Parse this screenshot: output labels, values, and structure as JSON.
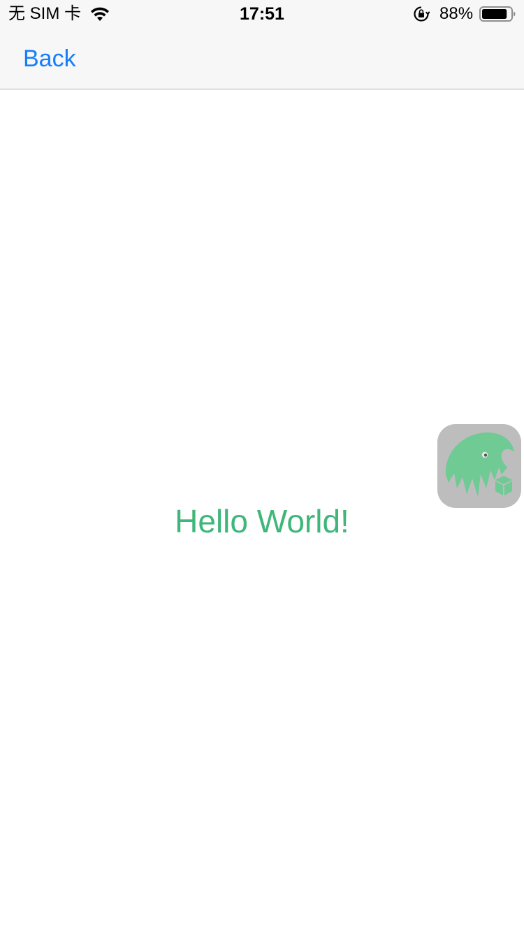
{
  "status_bar": {
    "carrier": "无 SIM 卡",
    "time": "17:51",
    "battery_percent": "88%",
    "battery_level": 0.88,
    "icons": [
      "wifi-icon",
      "orientation-lock-icon",
      "battery-icon"
    ]
  },
  "nav": {
    "back_label": "Back"
  },
  "content": {
    "message": "Hello World!"
  },
  "floating_button": {
    "icon": "eagle-logo-icon"
  },
  "colors": {
    "link_blue": "#157efb",
    "message_green": "#3fb67a",
    "logo_green": "#6fca94",
    "floating_bg": "#bdbdbd",
    "bar_bg": "#f7f7f7"
  }
}
